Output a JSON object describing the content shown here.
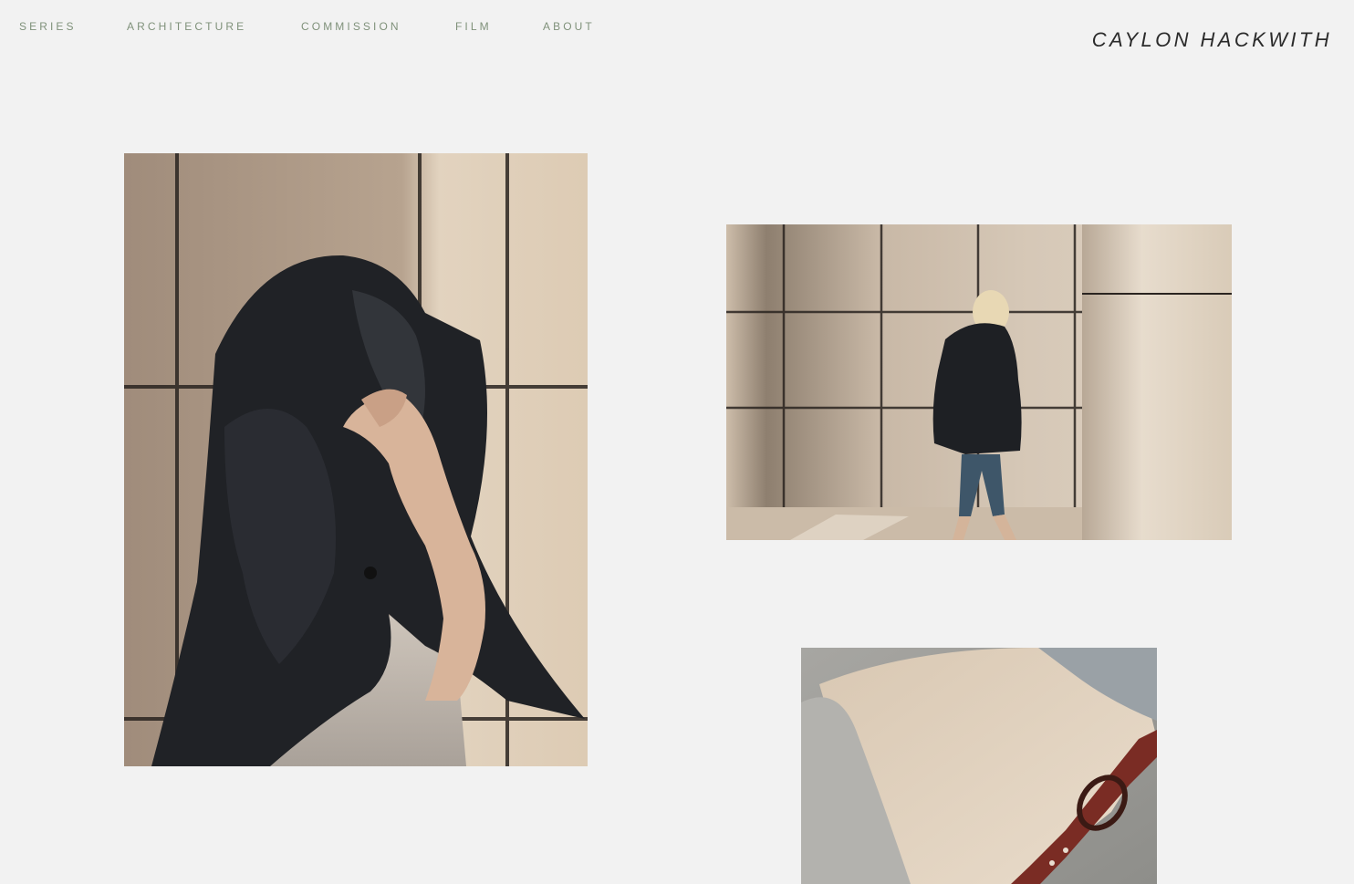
{
  "header": {
    "nav": [
      {
        "label": "SERIES"
      },
      {
        "label": "ARCHITECTURE"
      },
      {
        "label": "COMMISSION"
      },
      {
        "label": "FILM"
      },
      {
        "label": "ABOUT"
      }
    ],
    "brand": "CAYLON HACKWITH"
  },
  "colors": {
    "background": "#f2f2f2",
    "nav_text": "#7f917a",
    "brand_text": "#2b2b2b"
  },
  "gallery": {
    "images": [
      {
        "subject": "person covering head with black blazer against tiled wall"
      },
      {
        "subject": "blonde person in black jacket walking past tiled wall and column"
      },
      {
        "subject": "close-up of grey jacket with cream top and burgundy leather belt"
      }
    ]
  }
}
